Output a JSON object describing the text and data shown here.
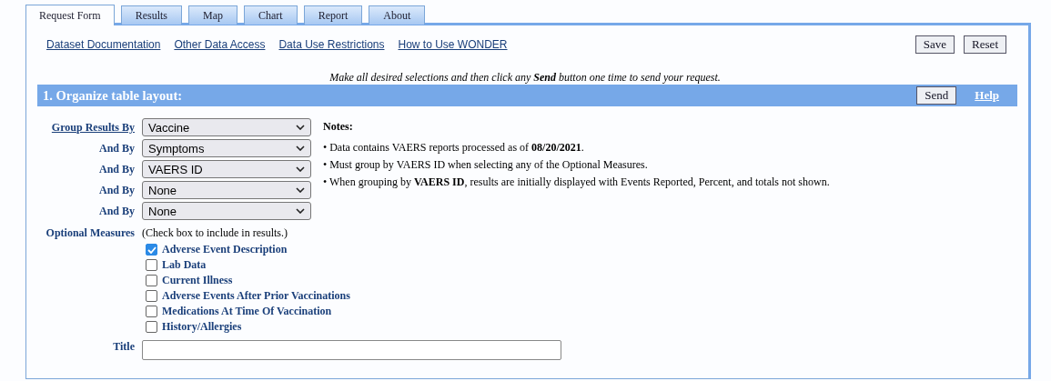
{
  "tabs": [
    {
      "label": "Request Form",
      "selected": true
    },
    {
      "label": "Results",
      "selected": false
    },
    {
      "label": "Map",
      "selected": false
    },
    {
      "label": "Chart",
      "selected": false
    },
    {
      "label": "Report",
      "selected": false
    },
    {
      "label": "About",
      "selected": false
    }
  ],
  "links": [
    "Dataset Documentation",
    "Other Data Access",
    "Data Use Restrictions",
    "How to Use WONDER"
  ],
  "top_buttons": [
    "Save",
    "Reset"
  ],
  "instruction": "Make all desired selections and then click any **Send** button one time to send your request.",
  "section": {
    "title": "1. Organize table layout:",
    "send_button": "Send",
    "help_link": "Help"
  },
  "group_by": [
    {
      "label": "Group Results By",
      "kind": "link",
      "value": "Vaccine"
    },
    {
      "label": "And By",
      "kind": "label",
      "value": "Symptoms"
    },
    {
      "label": "And By",
      "kind": "label",
      "value": "VAERS ID"
    },
    {
      "label": "And By",
      "kind": "label",
      "value": "None"
    },
    {
      "label": "And By",
      "kind": "label",
      "value": "None"
    }
  ],
  "notes": {
    "heading": "Notes:",
    "items": [
      "• Data contains VAERS reports processed as of **08/20/2021**.",
      "• Must group by VAERS ID when selecting any of the Optional Measures.",
      "• When grouping by **VAERS ID**, results are initially displayed with Events Reported, Percent, and totals not shown."
    ]
  },
  "optional_measures": {
    "label": "Optional Measures",
    "hint": "(Check box to include in results.)",
    "items": [
      {
        "label": "Adverse Event Description",
        "checked": true
      },
      {
        "label": "Lab Data",
        "checked": false
      },
      {
        "label": "Current Illness",
        "checked": false
      },
      {
        "label": "Adverse Events After Prior Vaccinations",
        "checked": false
      },
      {
        "label": "Medications At Time Of Vaccination",
        "checked": false
      },
      {
        "label": "History/Allergies",
        "checked": false
      }
    ]
  },
  "title_field": {
    "label": "Title"
  }
}
